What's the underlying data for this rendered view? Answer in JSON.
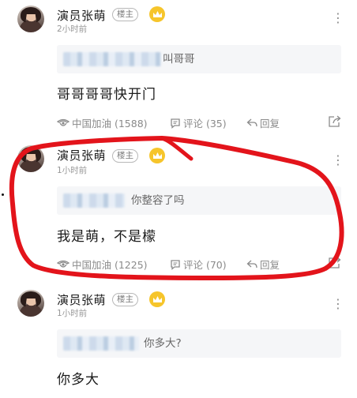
{
  "posts": [
    {
      "author": "演员张萌",
      "badge": "楼主",
      "time": "2小时前",
      "quote_text": "叫哥哥",
      "content": "哥哥哥哥快开门",
      "cheer": "中国加油 (1588)",
      "comments": "评论 (35)",
      "reply": "回复"
    },
    {
      "author": "演员张萌",
      "badge": "楼主",
      "time": "1小时前",
      "quote_text": "你整容了吗",
      "content": "我是萌，不是檬",
      "cheer": "中国加油 (1225)",
      "comments": "评论 (70)",
      "reply": "回复"
    },
    {
      "author": "演员张萌",
      "badge": "楼主",
      "time": "1小时前",
      "quote_text": "你多大?",
      "content": "你多大"
    }
  ],
  "icons": {
    "more": "more-vertical-icon",
    "crown": "crown-icon",
    "cheer": "eye-cheer-icon",
    "comment": "comment-icon",
    "reply": "reply-arrow-icon",
    "share": "share-icon"
  },
  "colors": {
    "crown": "#f6c52b",
    "annotation": "#e3141b",
    "quote_bg": "#f5f6f8"
  }
}
